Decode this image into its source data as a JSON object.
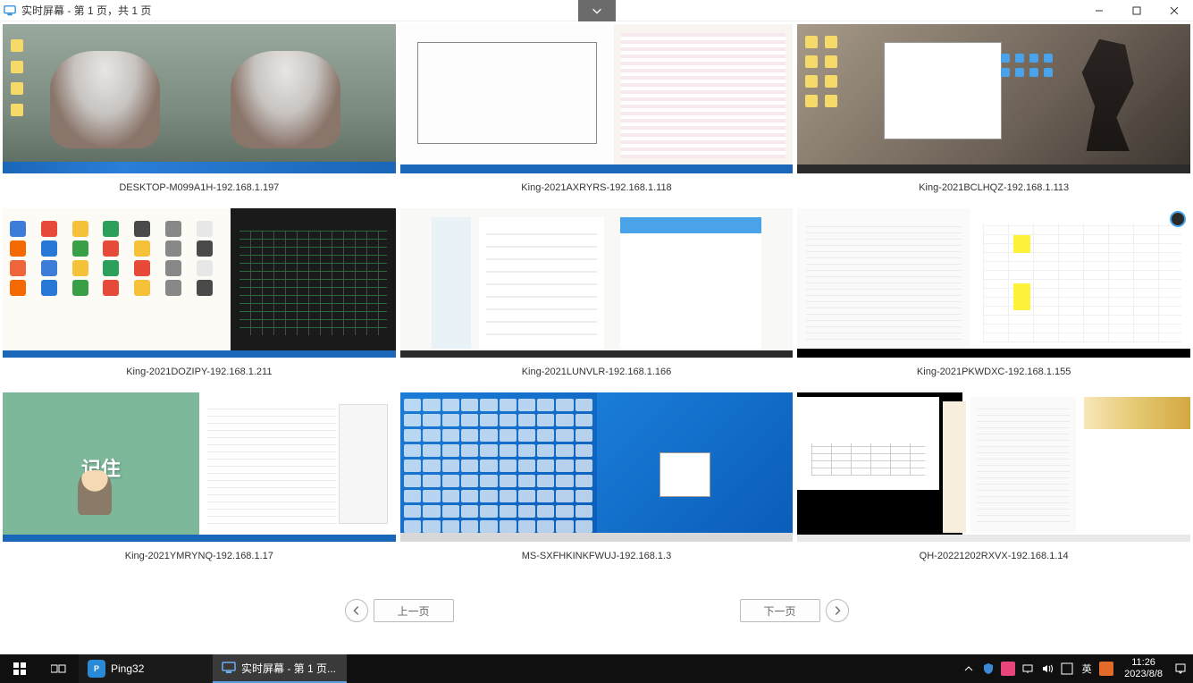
{
  "window": {
    "title": "实时屏幕 - 第 1 页，共 1 页",
    "dropdown_icon": "chevron-down",
    "controls": {
      "minimize": "—",
      "maximize": "□",
      "close": "✕"
    }
  },
  "screens": [
    {
      "label": "DESKTOP-M099A1H-192.168.1.197",
      "mock": "ultraman"
    },
    {
      "label": "King-2021AXRYRS-192.168.1.118",
      "mock": "cad"
    },
    {
      "label": "King-2021BCLHQZ-192.168.1.113",
      "mock": "anime"
    },
    {
      "label": "King-2021DOZIPY-192.168.1.211",
      "mock": "browser"
    },
    {
      "label": "King-2021LUNVLR-192.168.1.166",
      "mock": "chat"
    },
    {
      "label": "King-2021PKWDXC-192.168.1.155",
      "mock": "sheet"
    },
    {
      "label": "King-2021YMRYNQ-192.168.1.17",
      "mock": "cartoon"
    },
    {
      "label": "MS-SXFHKINKFWUJ-192.168.1.3",
      "mock": "windesk"
    },
    {
      "label": "QH-20221202RXVX-192.168.1.14",
      "mock": "multiapp"
    }
  ],
  "cartoon_text": "记住",
  "pager": {
    "prev": "上一页",
    "next": "下一页"
  },
  "taskbar": {
    "apps": [
      {
        "name": "Ping32",
        "icon": "ping"
      },
      {
        "name": "实时屏幕 - 第 1 页...",
        "icon": "monitor",
        "active": true
      }
    ],
    "tray": {
      "ime": "英",
      "time": "11:26",
      "date": "2023/8/8"
    }
  },
  "browser_tiles": [
    "#3b7dd8",
    "#e84a3a",
    "#f5c138",
    "#2aa05a",
    "#4a4a4a",
    "#888",
    "#e7e7e7",
    "#f56a00",
    "#2878d6",
    "#3aa048",
    "#e84a3a",
    "#f5c138",
    "#888",
    "#4a4a4a",
    "#f0643c",
    "#3b7dd8",
    "#f5c138",
    "#2aa05a",
    "#e84a3a",
    "#888",
    "#e7e7e7",
    "#f56a00",
    "#2878d6",
    "#3aa048",
    "#e84a3a",
    "#f5c138",
    "#888",
    "#4a4a4a"
  ]
}
